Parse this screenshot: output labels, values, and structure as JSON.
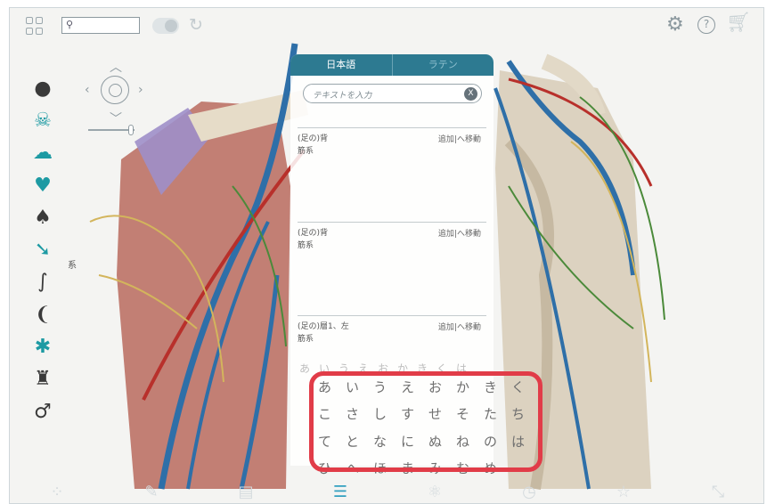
{
  "colors": {
    "accent": "#2d7a91",
    "highlight": "#e13c48",
    "active_tool": "#33a0c0"
  },
  "topbar": {
    "icons": [
      "grid-icon",
      "search-icon",
      "toggle",
      "reset-icon",
      "settings-icon",
      "help-icon",
      "cart-icon"
    ],
    "help_glyph": "?"
  },
  "sidebar": {
    "systems": [
      "body-icon",
      "skull-icon",
      "brain-icon",
      "heart-icon",
      "lungs-icon",
      "muscle-icon",
      "stomach-icon",
      "kidney-icon",
      "lymph-icon",
      "pelvis-icon",
      "male-icon"
    ],
    "muscle_label": "系"
  },
  "panel": {
    "tabs": [
      "日本語",
      "ラテン"
    ],
    "search_placeholder": "テキストを入力",
    "clear_label": "X",
    "results": [
      {
        "name_line1": "(足の)背",
        "name_line2": "筋系",
        "add": "追加",
        "sep": "|",
        "move": "へ移動"
      },
      {
        "name_line1": "(足の)背",
        "name_line2": "筋系",
        "add": "追加",
        "sep": "|",
        "move": "へ移動"
      },
      {
        "name_line1": "(足の)層1、左",
        "name_line2": "筋系",
        "add": "追加",
        "sep": "|",
        "move": "へ移動"
      }
    ]
  },
  "keyboard": {
    "ghost_row": "あいうえおかきくは",
    "rows": [
      [
        "あ",
        "い",
        "う",
        "え",
        "お",
        "か",
        "き",
        "く"
      ],
      [
        "こ",
        "さ",
        "し",
        "す",
        "せ",
        "そ",
        "た",
        "ち"
      ],
      [
        "て",
        "と",
        "な",
        "に",
        "ぬ",
        "ね",
        "の",
        "は"
      ],
      [
        "ひ",
        "へ",
        "ほ",
        "ま",
        "み",
        "む",
        "め",
        ""
      ]
    ]
  },
  "bottombar": {
    "tools": [
      "nodes-icon",
      "pencil-icon",
      "notes-icon",
      "list-icon",
      "atom-icon",
      "history-icon",
      "star-icon",
      "expand-icon"
    ],
    "active": "list-icon"
  }
}
